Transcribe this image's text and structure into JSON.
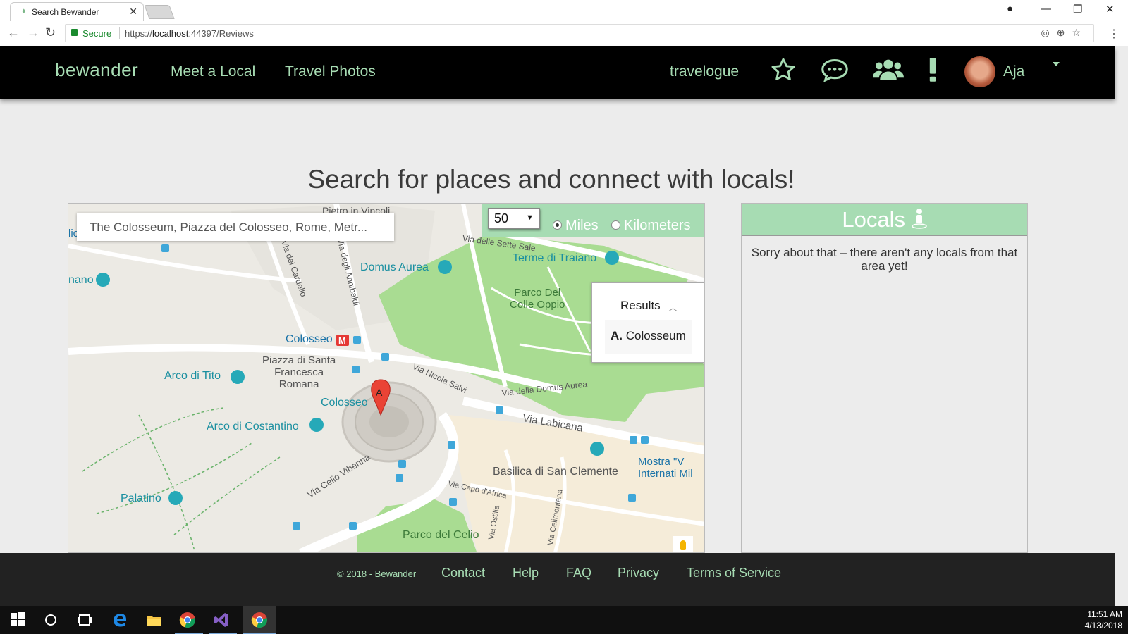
{
  "browser": {
    "tab_title": "Search Bewander",
    "secure_label": "Secure",
    "url_scheme": "https://",
    "url_host": "localhost",
    "url_rest": ":44397/Reviews"
  },
  "nav": {
    "brand": "bewander",
    "links": [
      "Meet a Local",
      "Travel Photos"
    ],
    "travelogue": "travelogue",
    "username": "Aja",
    "icons": [
      "star-icon",
      "chat-icon",
      "group-icon",
      "alert-icon"
    ]
  },
  "main": {
    "headline": "Search for places and connect with locals!",
    "search_value": "The Colosseum, Piazza del Colosseo, Rome, Metr...",
    "radius_value": "50",
    "unit_miles": "Miles",
    "unit_km": "Kilometers",
    "selected_unit": "Miles",
    "results_header": "Results",
    "result_letter": "A.",
    "result_name": "Colosseum",
    "marker_letter": "A"
  },
  "map_labels": {
    "domus_aurea": "Domus Aurea",
    "terme": "Terme di Traiano",
    "parco_oppio": "Parco Del\nColle Oppio",
    "colosseo_metro": "Colosseo",
    "piazza": "Piazza di Santa\nFrancesca\nRomana",
    "arco_tito": "Arco di Tito",
    "colosseo": "Colosseo",
    "arco_costantino": "Arco di Costantino",
    "palatino": "Palatino",
    "basilica_clemente": "Basilica di San Clemente",
    "mostra": "Mostra \"V\nInternati Mil",
    "parco_celio": "Parco del Celio",
    "via_labicana": "Via Labicana",
    "via_celio": "Via Celio Vibenna",
    "via_nicola": "Via Nicola Salvi",
    "via_domus": "Via della Domus Aurea",
    "via_sette": "Via delle Sette Sale",
    "via_annibaldi": "Via degli Annibaldi",
    "via_cardello": "Via del Cardello",
    "via_capo": "Via Capo d'Africa",
    "via_ostilia": "Via Ostilia",
    "via_celimontana": "Via Celimontana",
    "basilica_top": "Basilica di San\nPietro in Vincoli",
    "nano": "nano",
    "lic": "lic"
  },
  "locals": {
    "title": "Locals",
    "message": "Sorry about that – there aren't any locals from that area yet!"
  },
  "footer": {
    "copyright": "© 2018 - Bewander",
    "links": [
      "Contact",
      "Help",
      "FAQ",
      "Privacy",
      "Terms of Service"
    ]
  },
  "taskbar": {
    "time": "11:51 AM",
    "date": "4/13/2018"
  },
  "colors": {
    "brand_green": "#a7dcb3",
    "nav_bg": "#000000",
    "footer_bg": "#222222",
    "park_green": "#a9dc92",
    "marker_red": "#ea4335"
  }
}
